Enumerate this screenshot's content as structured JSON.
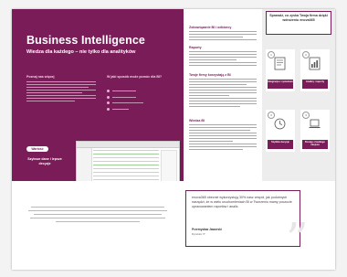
{
  "hero": {
    "title": "Business Intelligence",
    "subtitle": "Wiedza dla każdego – nie tylko dla analityków",
    "col1_heading": "Poznaj nas więcej",
    "col2_heading": "W jaki sposób może pomóc dla BI?",
    "pill_label": "Wartość",
    "tagline": "Szybsze dane i lepsze decyzje"
  },
  "middle": {
    "section1": "Zobowiązanie BI i odbiorcy",
    "section2": "Raporty",
    "section3": "Twoje firmy korzystają z BI",
    "section4": "Wiedza BI"
  },
  "right": {
    "callout": "Sprawdź, co zyska Twoja firma dzięki wdrożeniu enova365",
    "cards": [
      {
        "num": "1",
        "label": "Integracja z systemem",
        "icon": "document-icon"
      },
      {
        "num": "2",
        "label": "Analizy i raporty",
        "icon": "chart-document-icon"
      },
      {
        "num": "3",
        "label": "Szybkie decyzje",
        "icon": "clock-icon"
      },
      {
        "num": "4",
        "label": "Dostęp z każdego miejsca",
        "icon": "laptop-icon"
      }
    ]
  },
  "quote": {
    "text": "enova365 obecnie wykorzystują 30% nasz zespół, jak podobnych narzędzi, że w wielu uruchomieniach BI w Tworzeniu mamy poczucie opracowaniem raportów i analiz.",
    "author": "Przemysław Jaworski",
    "role": "Dyrektor IT"
  },
  "colors": {
    "brand": "#7a1c58",
    "panel": "#ededed"
  }
}
